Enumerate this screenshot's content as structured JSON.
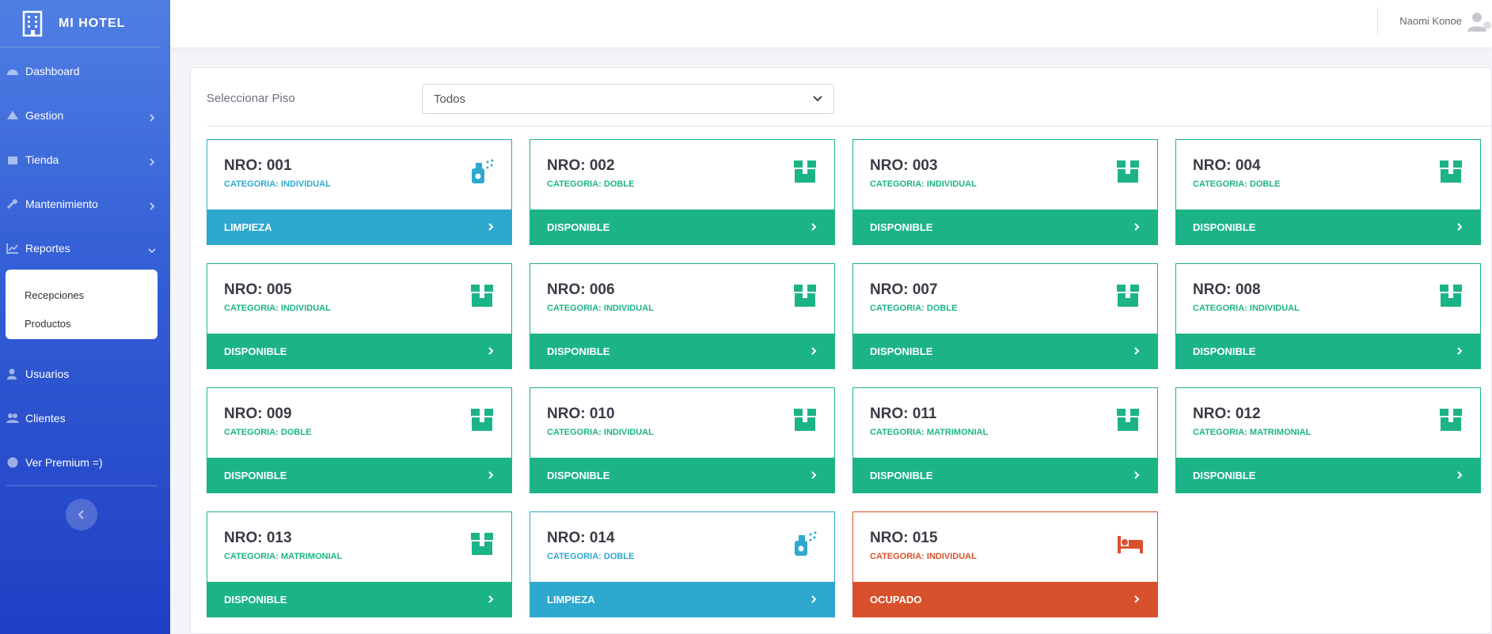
{
  "brand": {
    "name": "MI HOTEL"
  },
  "sidebar": {
    "items": [
      {
        "label": "Dashboard",
        "icon": "dashboard-icon",
        "chevron": ""
      },
      {
        "label": "Gestion",
        "icon": "gestion-icon",
        "chevron": "right"
      },
      {
        "label": "Tienda",
        "icon": "store-icon",
        "chevron": "right"
      },
      {
        "label": "Mantenimiento",
        "icon": "wrench-icon",
        "chevron": "right"
      },
      {
        "label": "Reportes",
        "icon": "chart-icon",
        "chevron": "down"
      },
      {
        "label": "Usuarios",
        "icon": "user-icon",
        "chevron": ""
      },
      {
        "label": "Clientes",
        "icon": "users-icon",
        "chevron": ""
      },
      {
        "label": "Ver Premium =)",
        "icon": "user-circle-icon",
        "chevron": ""
      }
    ],
    "submenu": [
      "Recepciones",
      "Productos"
    ]
  },
  "topbar": {
    "user_name": "Naomi Konoe"
  },
  "filter": {
    "label": "Seleccionar Piso",
    "selected": "Todos"
  },
  "colors": {
    "disponible": "#1cb487",
    "limpieza": "#2ea8cf",
    "ocupado": "#d9512c"
  },
  "rooms": [
    {
      "nro": "NRO: 001",
      "categoria": "CATEGORIA: INDIVIDUAL",
      "estado": "LIMPIEZA",
      "icon": "spray-icon"
    },
    {
      "nro": "NRO: 002",
      "categoria": "CATEGORIA: DOBLE",
      "estado": "DISPONIBLE",
      "icon": "box-icon"
    },
    {
      "nro": "NRO: 003",
      "categoria": "CATEGORIA: INDIVIDUAL",
      "estado": "DISPONIBLE",
      "icon": "box-icon"
    },
    {
      "nro": "NRO: 004",
      "categoria": "CATEGORIA: DOBLE",
      "estado": "DISPONIBLE",
      "icon": "box-icon"
    },
    {
      "nro": "NRO: 005",
      "categoria": "CATEGORIA: INDIVIDUAL",
      "estado": "DISPONIBLE",
      "icon": "box-icon"
    },
    {
      "nro": "NRO: 006",
      "categoria": "CATEGORIA: INDIVIDUAL",
      "estado": "DISPONIBLE",
      "icon": "box-icon"
    },
    {
      "nro": "NRO: 007",
      "categoria": "CATEGORIA: DOBLE",
      "estado": "DISPONIBLE",
      "icon": "box-icon"
    },
    {
      "nro": "NRO: 008",
      "categoria": "CATEGORIA: INDIVIDUAL",
      "estado": "DISPONIBLE",
      "icon": "box-icon"
    },
    {
      "nro": "NRO: 009",
      "categoria": "CATEGORIA: DOBLE",
      "estado": "DISPONIBLE",
      "icon": "box-icon"
    },
    {
      "nro": "NRO: 010",
      "categoria": "CATEGORIA: INDIVIDUAL",
      "estado": "DISPONIBLE",
      "icon": "box-icon"
    },
    {
      "nro": "NRO: 011",
      "categoria": "CATEGORIA: MATRIMONIAL",
      "estado": "DISPONIBLE",
      "icon": "box-icon"
    },
    {
      "nro": "NRO: 012",
      "categoria": "CATEGORIA: MATRIMONIAL",
      "estado": "DISPONIBLE",
      "icon": "box-icon"
    },
    {
      "nro": "NRO: 013",
      "categoria": "CATEGORIA: MATRIMONIAL",
      "estado": "DISPONIBLE",
      "icon": "box-icon"
    },
    {
      "nro": "NRO: 014",
      "categoria": "CATEGORIA: DOBLE",
      "estado": "LIMPIEZA",
      "icon": "spray-icon"
    },
    {
      "nro": "NRO: 015",
      "categoria": "CATEGORIA: INDIVIDUAL",
      "estado": "OCUPADO",
      "icon": "bed-icon"
    }
  ]
}
